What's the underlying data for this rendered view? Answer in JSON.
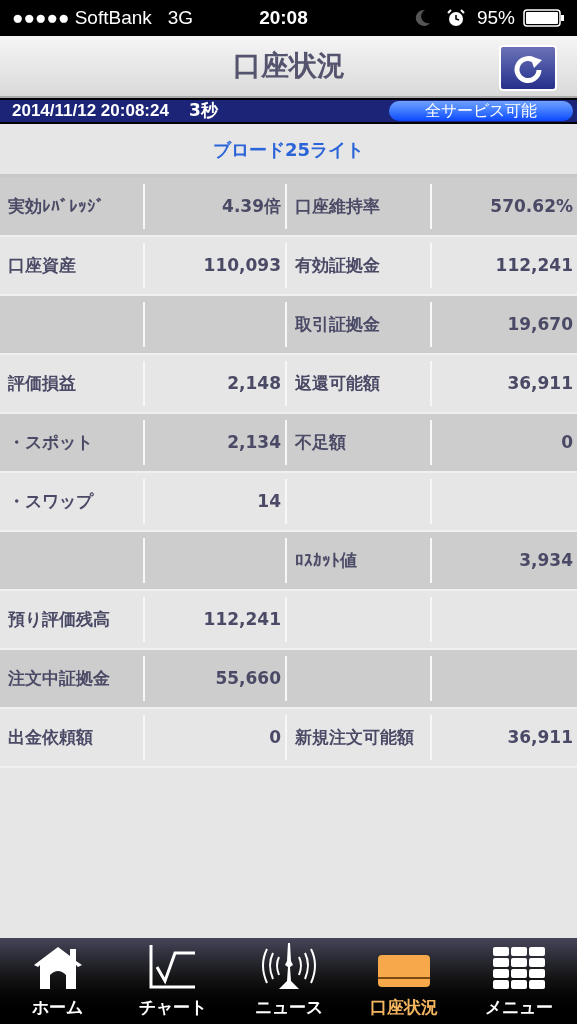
{
  "status_bar": {
    "carrier": "●●●●● SoftBank",
    "network": "3G",
    "time": "20:08",
    "battery": "95%"
  },
  "header": {
    "title": "口座状況"
  },
  "info_bar": {
    "datetime": "2014/11/12 20:08:24",
    "interval": "3秒",
    "service_status": "全サービス可能"
  },
  "course": "ブロード25ライト",
  "rows": [
    {
      "label_1": "実効ﾚﾊﾞﾚｯｼﾞ",
      "value_1": "4.39倍",
      "label_2": "口座維持率",
      "value_2": "570.62%"
    },
    {
      "label_1": "口座資産",
      "value_1": "110,093",
      "label_2": "有効証拠金",
      "value_2": "112,241"
    },
    {
      "label_2": "取引証拠金",
      "value_2": "19,670"
    },
    {
      "label_1": "評価損益",
      "value_1": "2,148",
      "label_2": "返還可能額",
      "value_2": "36,911"
    },
    {
      "label_1": "・スポット",
      "value_1": "2,134",
      "label_2": "不足額",
      "value_2": "0"
    },
    {
      "label_1": "・スワップ",
      "value_1": "14"
    },
    {
      "label_2": "ﾛｽｶｯﾄ値",
      "value_2": "3,934"
    },
    {
      "label_1": "預り評価残高",
      "value_1": "112,241"
    },
    {
      "label_1": "注文中証拠金",
      "value_1": "55,660"
    },
    {
      "label_1": "出金依頼額",
      "value_1": "0",
      "label_2": "新規注文可能額",
      "value_2": "36,911"
    }
  ],
  "tabs": [
    {
      "kind": "home",
      "label": "ホーム",
      "selected": false
    },
    {
      "kind": "chart",
      "label": "チャート",
      "selected": false
    },
    {
      "kind": "news",
      "label": "ニュース",
      "selected": false
    },
    {
      "kind": "account",
      "label": "口座状況",
      "selected": true
    },
    {
      "kind": "menu",
      "label": "メニュー",
      "selected": false
    }
  ]
}
